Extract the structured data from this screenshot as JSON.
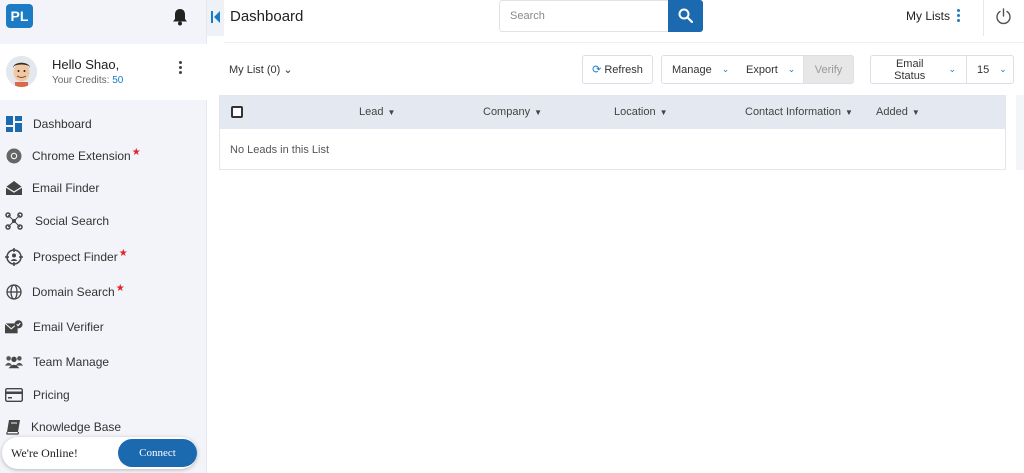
{
  "app": {
    "logo_text": "PL",
    "page_title": "Dashboard"
  },
  "user": {
    "greeting": "Hello Shao,",
    "credits_label": "Your Credits:",
    "credits_value": "50"
  },
  "sidebar": {
    "items": [
      {
        "label": "Dashboard",
        "icon": "dashboard-grid-icon",
        "star": false
      },
      {
        "label": "Chrome Extension",
        "icon": "chrome-icon",
        "star": true
      },
      {
        "label": "Email Finder",
        "icon": "envelope-open-icon",
        "star": false
      },
      {
        "label": "Social Search",
        "icon": "network-nodes-icon",
        "star": false
      },
      {
        "label": "Prospect Finder",
        "icon": "target-person-icon",
        "star": true
      },
      {
        "label": "Domain Search",
        "icon": "globe-icon",
        "star": true
      },
      {
        "label": "Email Verifier",
        "icon": "envelope-check-icon",
        "star": false
      },
      {
        "label": "Team Manage",
        "icon": "users-icon",
        "star": false
      },
      {
        "label": "Pricing",
        "icon": "credit-card-icon",
        "star": false
      },
      {
        "label": "Knowledge Base",
        "icon": "book-icon",
        "star": false
      }
    ]
  },
  "chat": {
    "status_text": "We're Online!",
    "connect_label": "Connect"
  },
  "header": {
    "search_placeholder": "Search",
    "my_lists_label": "My Lists"
  },
  "toolbar": {
    "list_select_label": "My List (0)",
    "refresh_label": "Refresh",
    "manage_label": "Manage",
    "export_label": "Export",
    "verify_label": "Verify",
    "email_status_label": "Email Status",
    "page_size_value": "15"
  },
  "table": {
    "columns": [
      "Lead",
      "Company",
      "Location",
      "Contact Information",
      "Added"
    ],
    "empty_message": "No Leads in this List"
  },
  "colors": {
    "accent": "#1b69ae",
    "sidebar_bg": "#f3f4f9",
    "star": "#e0262a",
    "table_header_bg": "#e4e8f0"
  }
}
